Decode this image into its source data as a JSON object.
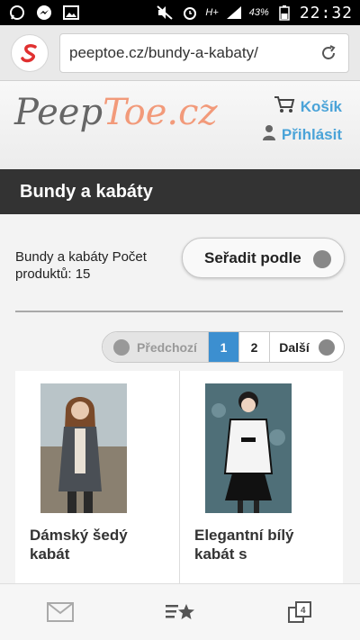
{
  "status": {
    "battery": "43%",
    "time": "22:32",
    "network": "H+"
  },
  "browser": {
    "url": "peeptoe.cz/bundy-a-kabaty/",
    "tabs_count": "4"
  },
  "site": {
    "logo_peep": "Peep",
    "logo_toe": "Toe.cz",
    "cart_label": "Košík",
    "login_label": "Přihlásit"
  },
  "page": {
    "title": "Bundy a kabáty",
    "count_text": "Bundy a kabáty Počet produktů: 15",
    "sort_label": "Seřadit podle"
  },
  "pagination": {
    "prev": "Předchozí",
    "pages": [
      "1",
      "2"
    ],
    "current": "1",
    "next": "Další"
  },
  "products": [
    {
      "name": "Dámský šedý kabát"
    },
    {
      "name": "Elegantní bílý kabát s"
    }
  ],
  "colors": {
    "accent": "#3c8fd0",
    "link": "#4aa3d8",
    "band": "#333333",
    "brand_toe": "#f29a7a"
  }
}
